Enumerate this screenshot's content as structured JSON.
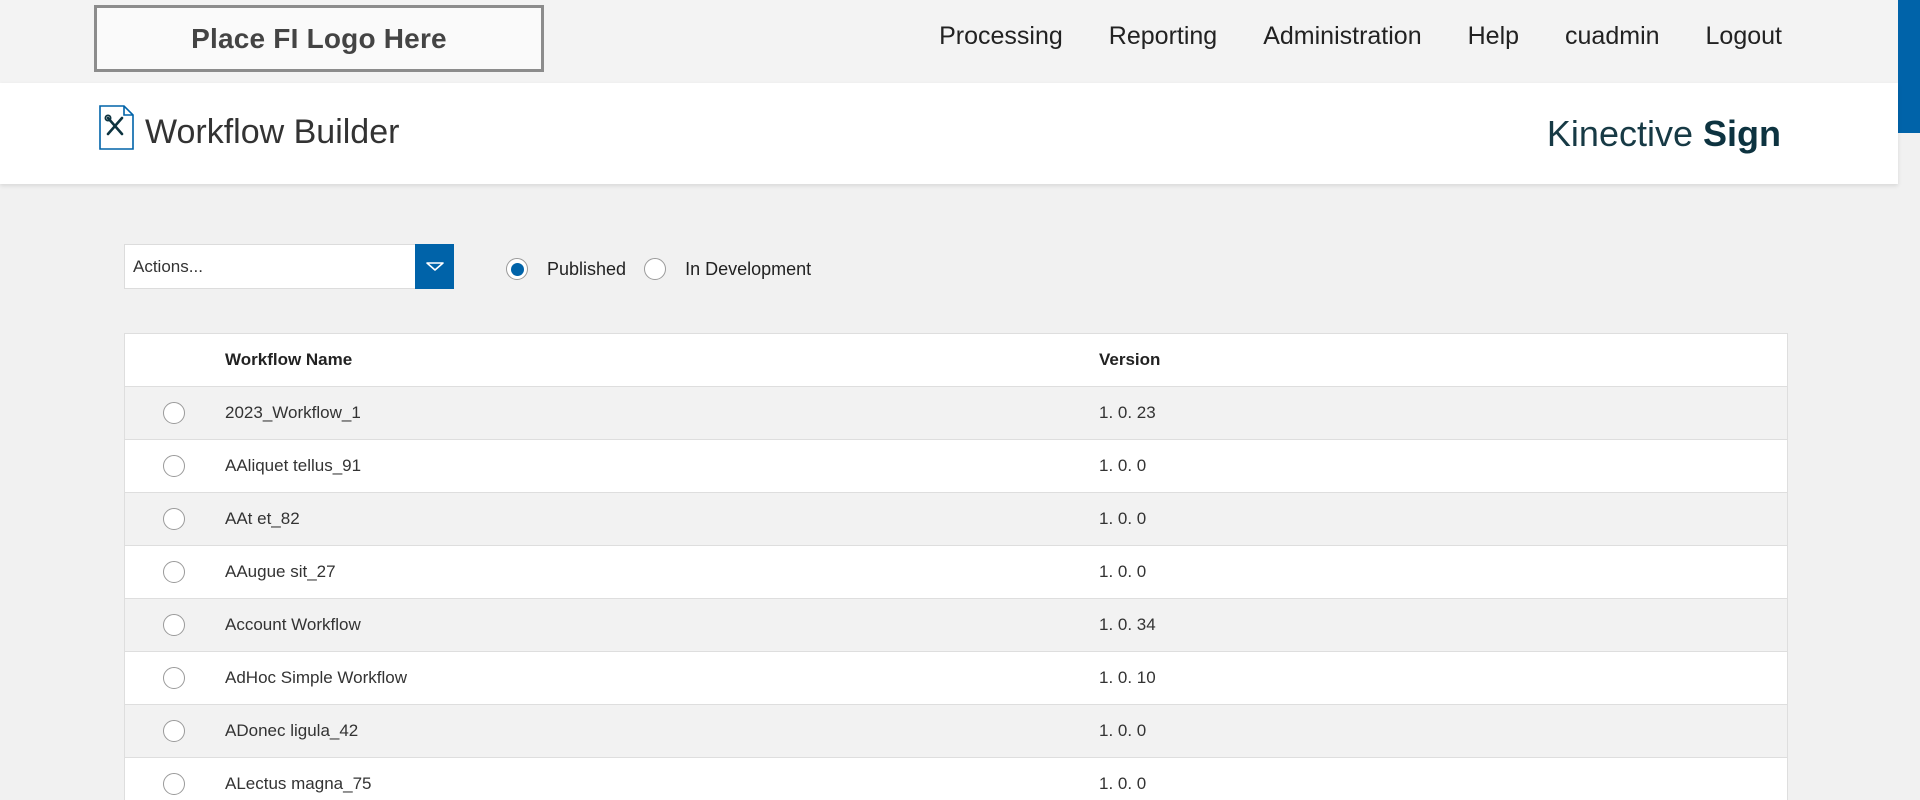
{
  "header": {
    "logo_text": "Place FI Logo Here",
    "nav": [
      "Processing",
      "Reporting",
      "Administration",
      "Help",
      "cuadmin",
      "Logout"
    ]
  },
  "page": {
    "title": "Workflow Builder",
    "brand_light": "Kinective",
    "brand_bold": "Sign"
  },
  "controls": {
    "actions_label": "Actions...",
    "filter_published": "Published",
    "filter_in_development": "In Development",
    "selected_filter": "Published"
  },
  "table": {
    "columns": {
      "name": "Workflow Name",
      "version": "Version"
    },
    "rows": [
      {
        "name": "2023_Workflow_1",
        "version": "1. 0. 23"
      },
      {
        "name": "AAliquet tellus_91",
        "version": "1. 0. 0"
      },
      {
        "name": "AAt et_82",
        "version": "1. 0. 0"
      },
      {
        "name": "AAugue sit_27",
        "version": "1. 0. 0"
      },
      {
        "name": "Account Workflow",
        "version": "1. 0. 34"
      },
      {
        "name": "AdHoc Simple Workflow",
        "version": "1. 0. 10"
      },
      {
        "name": "ADonec ligula_42",
        "version": "1. 0. 0"
      },
      {
        "name": "ALectus magna_75",
        "version": "1. 0. 0"
      }
    ]
  },
  "colors": {
    "accent": "#0063a9",
    "brand": "#0d3340",
    "background": "#f1f1f1"
  }
}
